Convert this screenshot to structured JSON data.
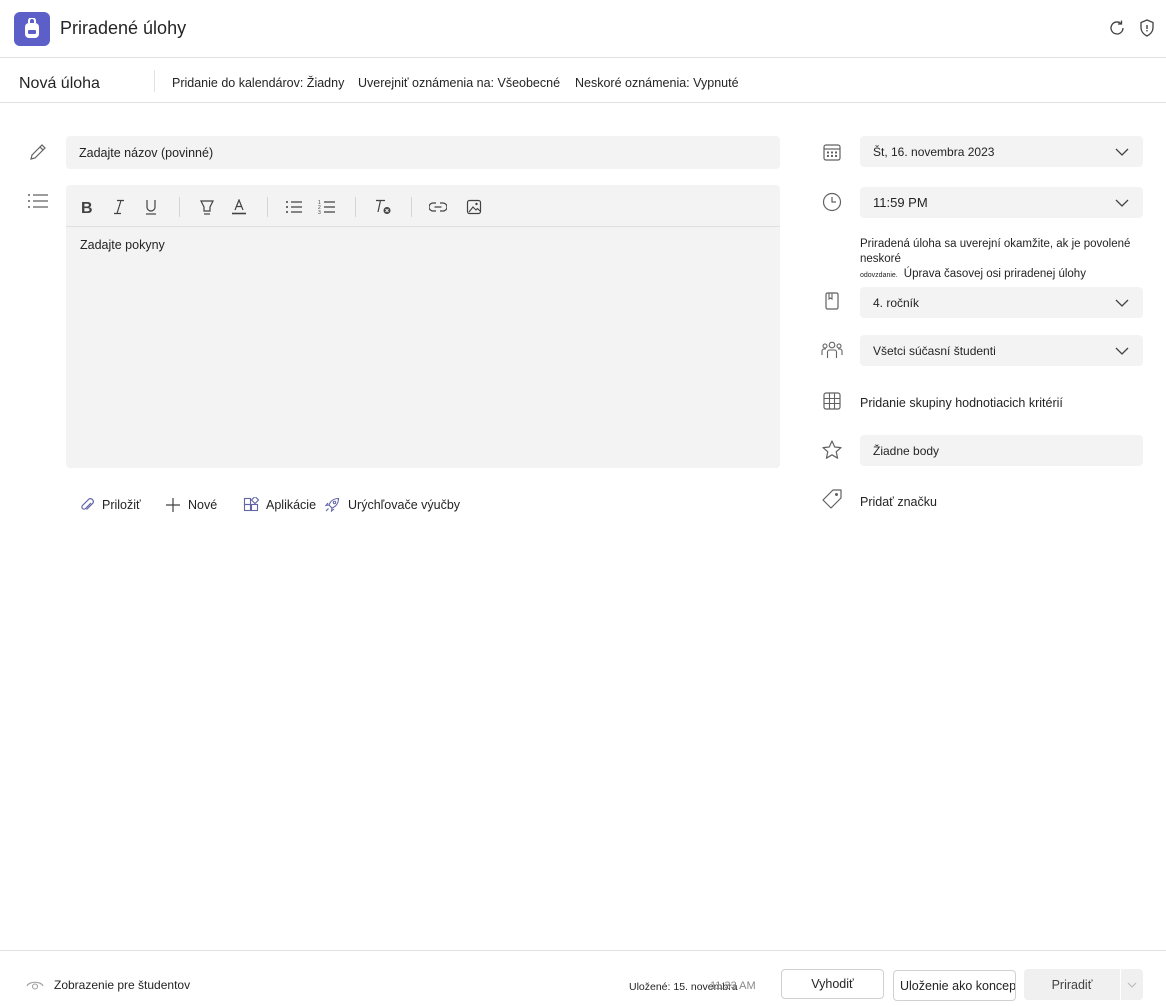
{
  "header": {
    "title": "Priradené úlohy",
    "logo_icon": "backpack-icon",
    "refresh_icon": "refresh-icon",
    "shield_icon": "shield-icon"
  },
  "subheader": {
    "new_task": "Nová úloha",
    "calendar": "Pridanie do kalendárov: Žiadny",
    "announce": "Uverejniť oznámenia na: Všeobecné",
    "late": "Neskoré oznámenia: Vypnuté"
  },
  "form": {
    "title_placeholder": "Zadajte názov (povinné)",
    "instructions_placeholder": "Zadajte pokyny",
    "attach": "Priložiť",
    "new": "Nové",
    "apps": "Aplikácie",
    "accelerators": "Urýchľovače výučby"
  },
  "right": {
    "date": "Št, 16. novembra 2023",
    "time": "11:59 PM",
    "note_main": "Priradená úloha sa uverejní okamžite, ak je povolené neskoré",
    "note_small": "odovzdanie.",
    "note_link": "Úprava časovej osi priradenej úlohy",
    "class": "4. ročník",
    "students": "Všetci súčasní študenti",
    "rubric": "Pridanie skupiny hodnotiacich kritérií",
    "points": "Žiadne body",
    "tag": "Pridať značku"
  },
  "footer": {
    "student_view": "Zobrazenie pre študentov",
    "saved": "Uložené: 15. novembra",
    "saved_time": "11:33 AM",
    "discard": "Vyhodiť",
    "save_draft": "Uloženie ako konceptu",
    "assign": "Priradiť"
  },
  "colors": {
    "brand": "#5b5fc7",
    "field_bg": "#f3f3f3"
  }
}
